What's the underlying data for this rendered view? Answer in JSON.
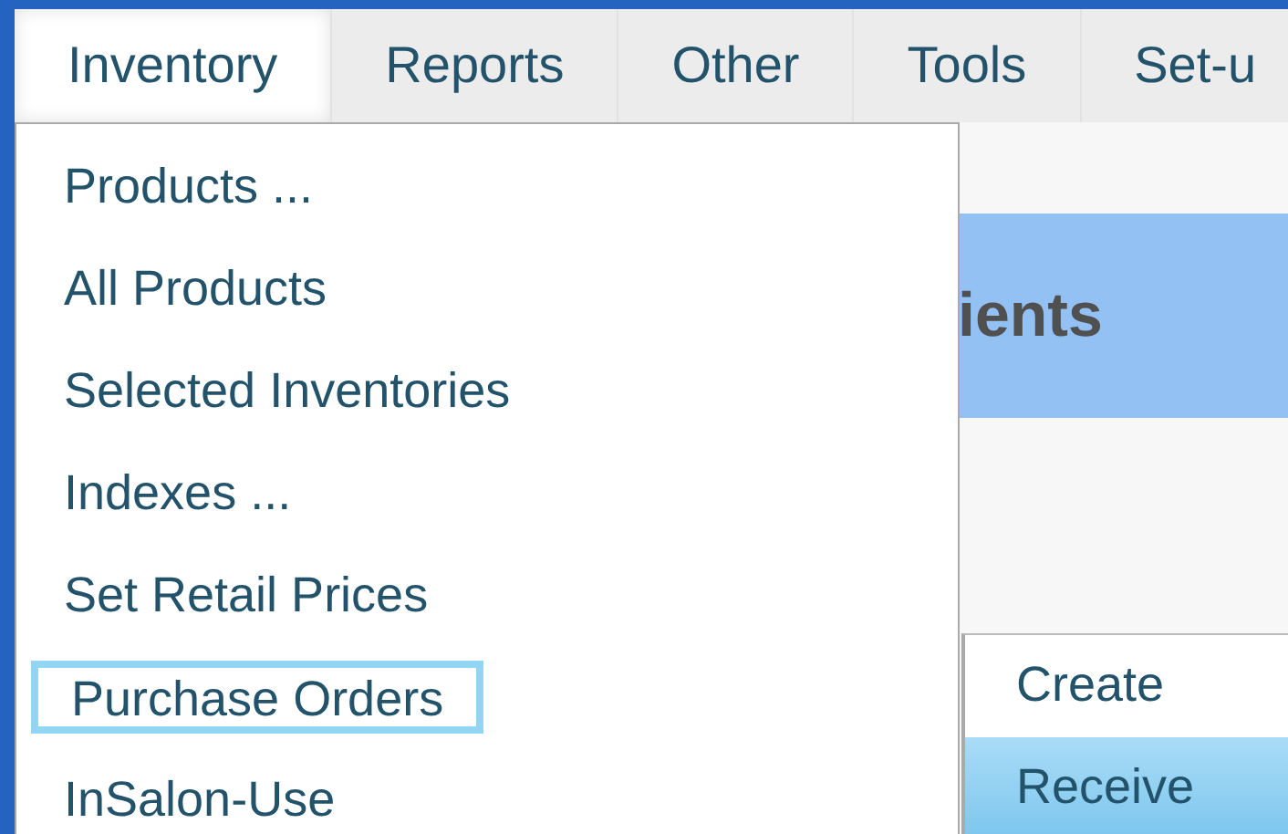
{
  "menubar": [
    {
      "label": "Inventory",
      "selected": true
    },
    {
      "label": "Reports",
      "selected": false
    },
    {
      "label": "Other",
      "selected": false
    },
    {
      "label": "Tools",
      "selected": false
    },
    {
      "label": "Set-u",
      "selected": false
    }
  ],
  "page_header": {
    "title": "ients"
  },
  "dropdown": {
    "items": [
      {
        "label": "Products ...",
        "focused": false
      },
      {
        "label": "All Products",
        "focused": false
      },
      {
        "label": "Selected Inventories",
        "focused": false
      },
      {
        "label": "Indexes ...",
        "focused": false
      },
      {
        "label": "Set Retail Prices",
        "focused": false
      },
      {
        "label": "Purchase Orders",
        "focused": true
      },
      {
        "label": "InSalon-Use",
        "focused": false
      }
    ]
  },
  "submenu": {
    "items": [
      {
        "label": "Create",
        "selected": false
      },
      {
        "label": "Receive",
        "selected": true
      }
    ]
  }
}
